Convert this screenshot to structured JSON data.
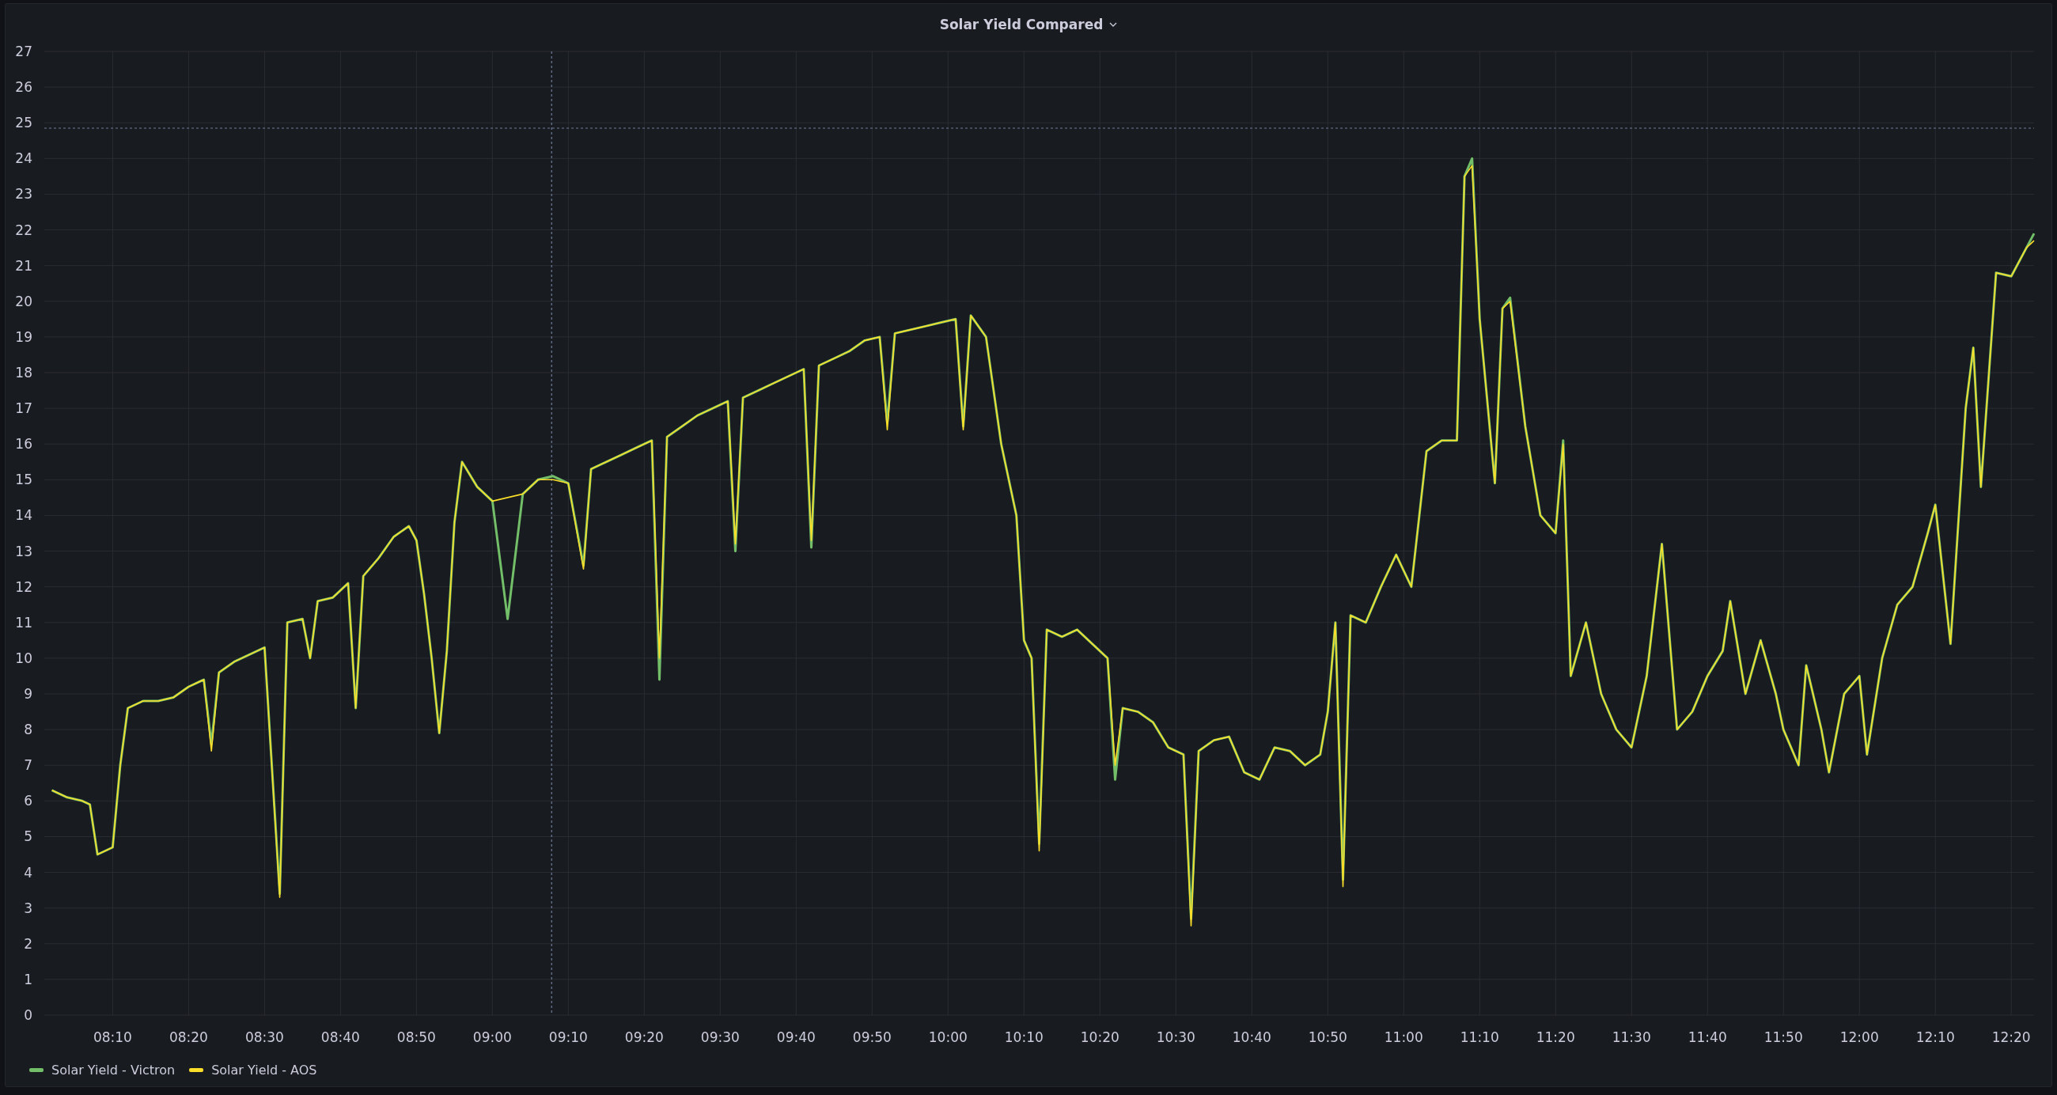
{
  "panel": {
    "title": "Solar Yield Compared",
    "chart_data": {
      "type": "line",
      "xlim": [
        481,
        743
      ],
      "ylim": [
        0,
        27
      ],
      "yticks": [
        0,
        1,
        2,
        3,
        4,
        5,
        6,
        7,
        8,
        9,
        10,
        11,
        12,
        13,
        14,
        15,
        16,
        17,
        18,
        19,
        20,
        21,
        22,
        23,
        24,
        25,
        26,
        27
      ],
      "xticks": [
        {
          "value": 490,
          "label": "08:10"
        },
        {
          "value": 500,
          "label": "08:20"
        },
        {
          "value": 510,
          "label": "08:30"
        },
        {
          "value": 520,
          "label": "08:40"
        },
        {
          "value": 530,
          "label": "08:50"
        },
        {
          "value": 540,
          "label": "09:00"
        },
        {
          "value": 550,
          "label": "09:10"
        },
        {
          "value": 560,
          "label": "09:20"
        },
        {
          "value": 570,
          "label": "09:30"
        },
        {
          "value": 580,
          "label": "09:40"
        },
        {
          "value": 590,
          "label": "09:50"
        },
        {
          "value": 600,
          "label": "10:00"
        },
        {
          "value": 610,
          "label": "10:10"
        },
        {
          "value": 620,
          "label": "10:20"
        },
        {
          "value": 630,
          "label": "10:30"
        },
        {
          "value": 640,
          "label": "10:40"
        },
        {
          "value": 650,
          "label": "10:50"
        },
        {
          "value": 660,
          "label": "11:00"
        },
        {
          "value": 670,
          "label": "11:10"
        },
        {
          "value": 680,
          "label": "11:20"
        },
        {
          "value": 690,
          "label": "11:30"
        },
        {
          "value": 700,
          "label": "11:40"
        },
        {
          "value": 710,
          "label": "11:50"
        },
        {
          "value": 720,
          "label": "12:00"
        },
        {
          "value": 730,
          "label": "12:10"
        },
        {
          "value": 740,
          "label": "12:20"
        }
      ],
      "grid": true,
      "ref_lines": [
        {
          "axis": "y",
          "value": 24.85
        },
        {
          "axis": "x",
          "value": 547.8
        }
      ],
      "x": [
        482,
        484,
        486,
        487,
        488,
        490,
        491,
        492,
        494,
        496,
        498,
        500,
        502,
        503,
        504,
        506,
        508,
        510,
        512,
        513,
        515,
        516,
        517,
        519,
        521,
        522,
        523,
        525,
        527,
        529,
        530,
        531,
        532,
        533,
        534,
        535,
        536,
        538,
        540,
        542,
        544,
        546,
        548,
        550,
        552,
        553,
        555,
        557,
        559,
        561,
        562,
        563,
        565,
        567,
        569,
        571,
        572,
        573,
        575,
        577,
        579,
        581,
        582,
        583,
        585,
        587,
        589,
        591,
        592,
        593,
        595,
        597,
        599,
        601,
        602,
        603,
        605,
        607,
        609,
        610,
        611,
        612,
        613,
        615,
        617,
        619,
        621,
        622,
        623,
        625,
        627,
        629,
        631,
        632,
        633,
        635,
        637,
        639,
        641,
        643,
        645,
        647,
        649,
        650,
        651,
        652,
        653,
        655,
        657,
        659,
        661,
        663,
        665,
        667,
        668,
        669,
        670,
        672,
        673,
        674,
        676,
        678,
        680,
        681,
        682,
        684,
        686,
        688,
        690,
        692,
        694,
        696,
        698,
        700,
        702,
        703,
        705,
        707,
        709,
        710,
        712,
        713,
        715,
        716,
        718,
        720,
        721,
        723,
        725,
        727,
        729,
        730,
        732,
        734,
        735,
        736,
        738,
        740,
        742,
        743
      ],
      "series": [
        {
          "name": "Solar Yield - Victron",
          "color": "#73bf69",
          "values": [
            6.3,
            6.1,
            6.0,
            5.9,
            4.5,
            4.7,
            7.0,
            8.6,
            8.8,
            8.8,
            8.9,
            9.2,
            9.4,
            7.6,
            9.6,
            9.9,
            10.1,
            10.3,
            3.4,
            11.0,
            11.1,
            10.0,
            11.6,
            11.7,
            12.1,
            8.6,
            12.3,
            12.8,
            13.4,
            13.7,
            13.3,
            11.8,
            10.0,
            7.9,
            10.2,
            13.8,
            15.5,
            14.8,
            14.4,
            11.1,
            14.6,
            15.0,
            15.1,
            14.9,
            12.6,
            15.3,
            15.5,
            15.7,
            15.9,
            16.1,
            9.4,
            16.2,
            16.5,
            16.8,
            17.0,
            17.2,
            13.0,
            17.3,
            17.5,
            17.7,
            17.9,
            18.1,
            13.1,
            18.2,
            18.4,
            18.6,
            18.9,
            19.0,
            16.6,
            19.1,
            19.2,
            19.3,
            19.4,
            19.5,
            16.5,
            19.6,
            19.0,
            16.0,
            14.0,
            10.5,
            10.0,
            4.8,
            10.8,
            10.6,
            10.8,
            10.4,
            10.0,
            6.6,
            8.6,
            8.5,
            8.2,
            7.5,
            7.3,
            2.7,
            7.4,
            7.7,
            7.8,
            6.8,
            6.6,
            7.5,
            7.4,
            7.0,
            7.3,
            8.5,
            11.0,
            3.8,
            11.2,
            11.0,
            12.0,
            12.9,
            12.0,
            15.8,
            16.1,
            16.1,
            23.5,
            24.0,
            19.5,
            14.9,
            19.8,
            20.1,
            16.5,
            14.0,
            13.5,
            16.1,
            9.5,
            11.0,
            9.0,
            8.0,
            7.5,
            9.5,
            13.2,
            8.0,
            8.5,
            9.5,
            10.2,
            11.6,
            9.0,
            10.5,
            9.0,
            8.0,
            7.0,
            9.8,
            8.0,
            6.8,
            9.0,
            9.5,
            7.3,
            10.0,
            11.5,
            12.0,
            13.5,
            14.3,
            10.4,
            17.0,
            18.7,
            14.8,
            20.8,
            20.7,
            21.5,
            21.9
          ]
        },
        {
          "name": "Solar Yield - AOS",
          "color": "#fade2a",
          "values": [
            6.3,
            6.1,
            6.0,
            5.9,
            4.5,
            4.7,
            7.0,
            8.6,
            8.8,
            8.8,
            8.9,
            9.2,
            9.4,
            7.4,
            9.6,
            9.9,
            10.1,
            10.3,
            3.3,
            11.0,
            11.1,
            10.0,
            11.6,
            11.7,
            12.1,
            8.6,
            12.3,
            12.8,
            13.4,
            13.7,
            13.3,
            11.8,
            10.0,
            7.9,
            10.2,
            13.8,
            15.5,
            14.8,
            14.4,
            14.5,
            14.6,
            15.0,
            15.0,
            14.9,
            12.5,
            15.3,
            15.5,
            15.7,
            15.9,
            16.1,
            10.0,
            16.2,
            16.5,
            16.8,
            17.0,
            17.2,
            13.2,
            17.3,
            17.5,
            17.7,
            17.9,
            18.1,
            13.3,
            18.2,
            18.4,
            18.6,
            18.9,
            19.0,
            16.4,
            19.1,
            19.2,
            19.3,
            19.4,
            19.5,
            16.4,
            19.6,
            19.0,
            16.0,
            14.0,
            10.5,
            10.0,
            4.6,
            10.8,
            10.6,
            10.8,
            10.4,
            10.0,
            7.0,
            8.6,
            8.5,
            8.2,
            7.5,
            7.3,
            2.5,
            7.4,
            7.7,
            7.8,
            6.8,
            6.6,
            7.5,
            7.4,
            7.0,
            7.3,
            8.5,
            11.0,
            3.6,
            11.2,
            11.0,
            12.0,
            12.9,
            12.0,
            15.8,
            16.1,
            16.1,
            23.5,
            23.8,
            19.5,
            14.9,
            19.8,
            20.0,
            16.5,
            14.0,
            13.5,
            16.0,
            9.5,
            11.0,
            9.0,
            8.0,
            7.5,
            9.5,
            13.2,
            8.0,
            8.5,
            9.5,
            10.2,
            11.6,
            9.0,
            10.5,
            9.0,
            8.0,
            7.0,
            9.8,
            8.0,
            6.8,
            9.0,
            9.5,
            7.3,
            10.0,
            11.5,
            12.0,
            13.5,
            14.3,
            10.4,
            17.0,
            18.7,
            14.8,
            20.8,
            20.7,
            21.5,
            21.7
          ]
        }
      ]
    }
  }
}
